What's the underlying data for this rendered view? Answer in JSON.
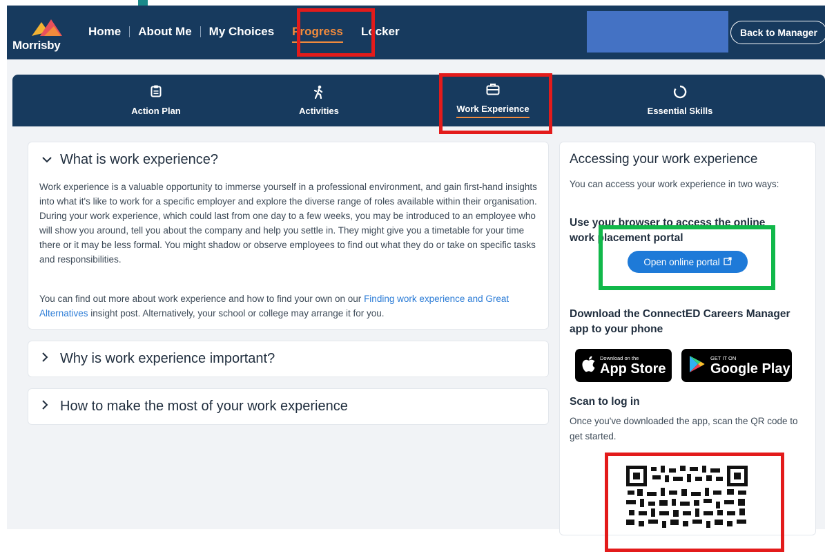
{
  "brand": {
    "name": "Morrisby"
  },
  "nav": {
    "home": "Home",
    "about": "About Me",
    "choices": "My Choices",
    "progress": "Progress",
    "locker": "Locker",
    "back_to_manager": "Back to Manager"
  },
  "subnav": [
    {
      "label": "Action Plan",
      "icon": "clipboard-icon"
    },
    {
      "label": "Activities",
      "icon": "hiker-icon"
    },
    {
      "label": "Work Experience",
      "icon": "briefcase-icon"
    },
    {
      "label": "Essential Skills",
      "icon": "circle-progress-icon"
    }
  ],
  "accordion": {
    "q1": "What is work experience?",
    "q1_body_1": "Work experience is a valuable opportunity to immerse yourself in a professional environment, and gain first-hand insights into what it's like to work for a specific employer and explore the diverse range of roles available within their organisation. During your work experience, which could last from one day to a few weeks, you may be introduced to an employee who will show you around, tell you about the company and help you settle in. They might give you a timetable for your time there or it may be less formal. You might shadow or observe employees to find out what they do or take on specific tasks and responsibilities.",
    "q1_body_2_pre": "You can find out more about work experience and how to find your own on our ",
    "q1_body_2_link": "Finding work experience and Great Alternatives",
    "q1_body_2_post": " insight post. Alternatively, your school or college may arrange it for you.",
    "q2": "Why is work experience important?",
    "q3": "How to make the most of your work experience"
  },
  "side": {
    "heading": "Accessing your work experience",
    "intro": "You can access your work experience in two ways:",
    "browser_heading_line1": "Use your browser to access the online",
    "browser_heading_line2": "work placement portal",
    "portal_button": "Open online portal",
    "app_heading": "Download the ConnectED Careers Manager app to your phone",
    "appstore_small": "Download on the",
    "appstore_big": "App Store",
    "googleplay_small": "GET IT ON",
    "googleplay_big": "Google Play",
    "scan_heading": "Scan to log in",
    "scan_text": "Once you've downloaded the app, scan the QR code to get started."
  },
  "colors": {
    "navy": "#173a5e",
    "accent_orange": "#f28b3c",
    "link_blue": "#2a7bd6",
    "highlight_red": "#e31b1b",
    "highlight_green": "#11b84a"
  }
}
